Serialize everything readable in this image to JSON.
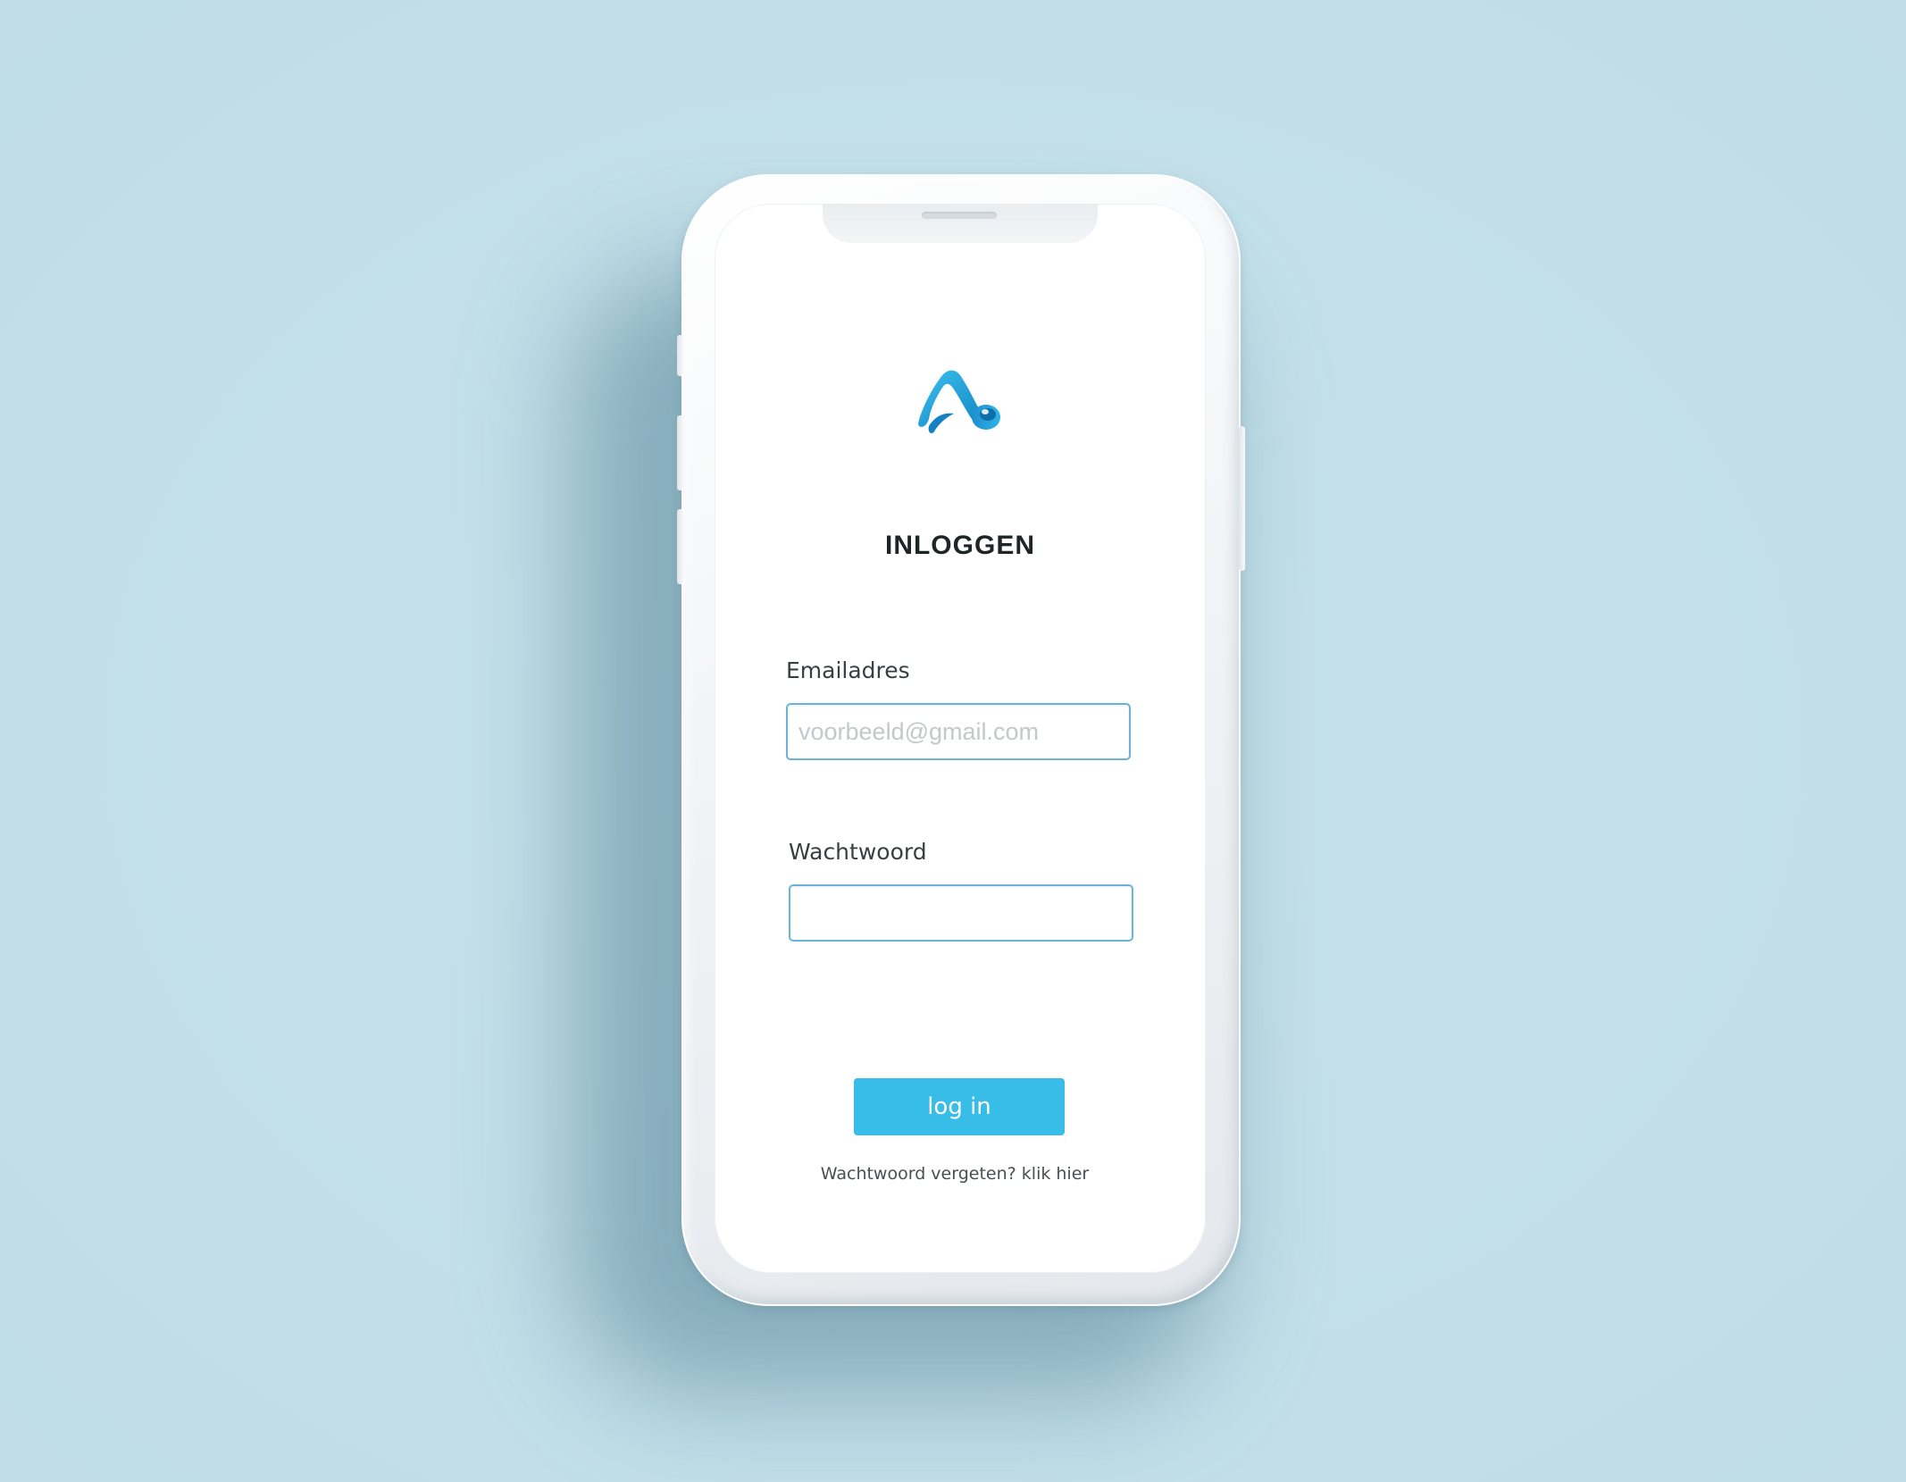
{
  "screen": {
    "title": "INLOGGEN"
  },
  "email": {
    "label": "Emailadres",
    "placeholder": "voorbeeld@gmail.com",
    "value": ""
  },
  "password": {
    "label": "Wachtwoord",
    "value": ""
  },
  "login_button": {
    "label": "log in"
  },
  "forgot": {
    "prefix": "Wachtwoord vergeten?",
    "link": "klik hier"
  },
  "logo": {
    "icon": "brand-logo-icon"
  },
  "colors": {
    "background": "#c4e0ea",
    "accent": "#38bde8",
    "input_border": "#6ab4d8",
    "logo_blue": "#1a9ad6"
  }
}
